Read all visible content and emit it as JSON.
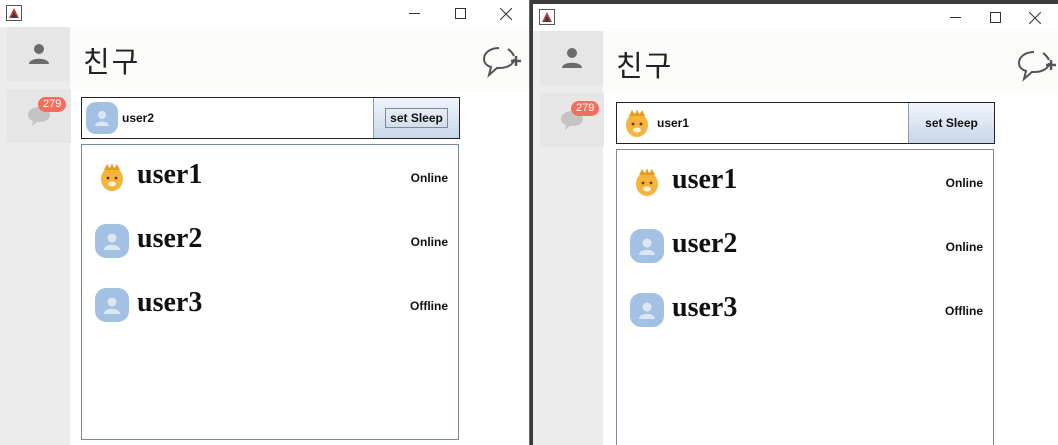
{
  "left_window": {
    "title": "친구",
    "badge_count": "279",
    "search": {
      "user_name": "user2",
      "avatar": "default-avatar-icon",
      "button_label": "set Sleep"
    },
    "friends": [
      {
        "name": "user1",
        "status": "Online",
        "avatar": "lion-avatar-icon"
      },
      {
        "name": "user2",
        "status": "Online",
        "avatar": "default-avatar-icon"
      },
      {
        "name": "user3",
        "status": "Offline",
        "avatar": "default-avatar-icon"
      }
    ]
  },
  "right_window": {
    "title": "친구",
    "badge_count": "279",
    "search": {
      "user_name": "user1",
      "avatar": "lion-avatar-icon",
      "button_label": "set Sleep"
    },
    "friends": [
      {
        "name": "user1",
        "status": "Online",
        "avatar": "lion-avatar-icon"
      },
      {
        "name": "user2",
        "status": "Online",
        "avatar": "default-avatar-icon"
      },
      {
        "name": "user3",
        "status": "Offline",
        "avatar": "default-avatar-icon"
      }
    ]
  },
  "colors": {
    "badge": "#f26f5f",
    "default_avatar": "#a3c1e3",
    "lion_avatar": "#f6b43c",
    "sidebar": "#ececec",
    "button_gradient_bottom": "#c9d7e8"
  }
}
